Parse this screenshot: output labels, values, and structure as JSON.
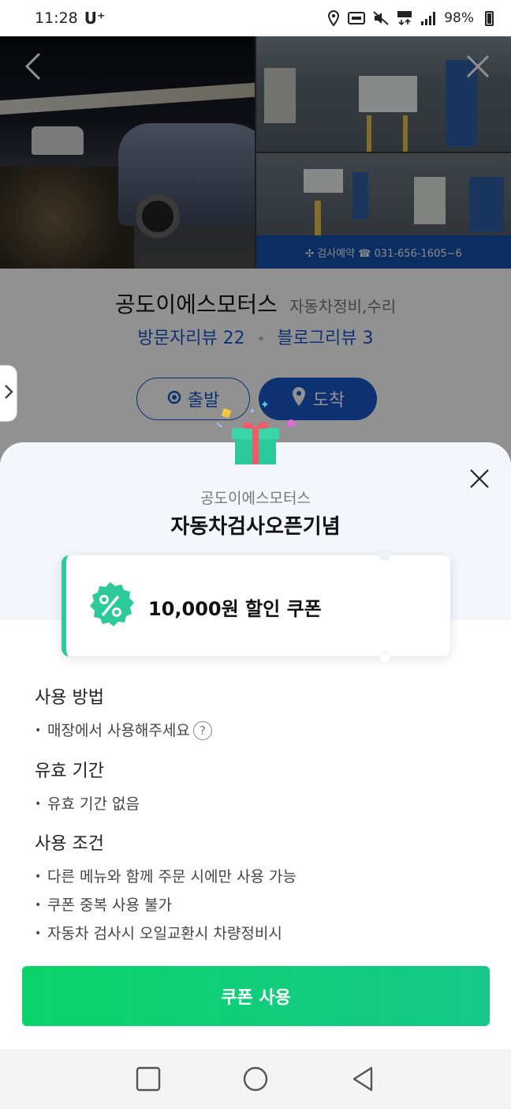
{
  "status_bar": {
    "time": "11:28",
    "carrier": "U⁺",
    "battery": "98%"
  },
  "gallery": {
    "banner_text": "✣ 검사예약  ☎ 031-656-1605~6"
  },
  "place": {
    "name": "공도이에스모터스",
    "category": "자동차정비,수리",
    "visitor_reviews": "방문자리뷰 22",
    "blog_reviews": "블로그리뷰 3",
    "depart_label": "출발",
    "arrive_label": "도착"
  },
  "coupon_sheet": {
    "store_name": "공도이에스모터스",
    "event_title": "자동차검사오픈기념",
    "coupon_text": "10,000원 할인 쿠폰",
    "sections": [
      {
        "title": "사용 방법",
        "items": [
          "매장에서 사용해주세요"
        ]
      },
      {
        "title": "유효 기간",
        "items": [
          "유효 기간 없음"
        ]
      },
      {
        "title": "사용 조건",
        "items": [
          "다른 메뉴와 함께 주문 시에만 사용 가능",
          "쿠폰 중복 사용 불가",
          "자동차 검사시 오일교환시 차량정비시"
        ]
      }
    ],
    "use_button": "쿠폰 사용"
  },
  "colors": {
    "accent_blue": "#1a57c8",
    "coupon_green": "#2cc99a",
    "button_green": "#0bd46c"
  }
}
